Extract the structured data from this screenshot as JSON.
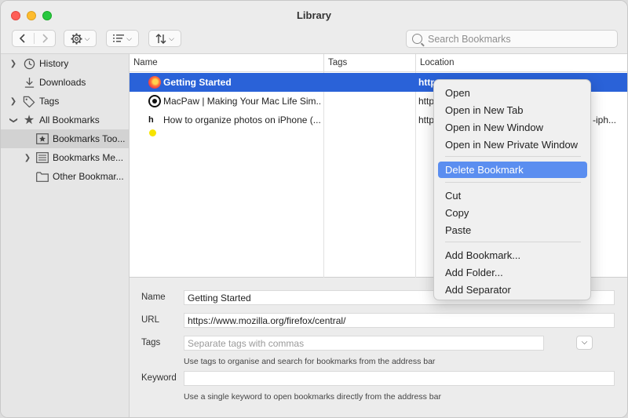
{
  "window": {
    "title": "Library"
  },
  "toolbar": {
    "back_icon": "chevron-left-icon",
    "forward_icon": "chevron-right-icon",
    "organize_icon": "gear-icon",
    "views_icon": "list-icon",
    "sort_icon": "sort-icon",
    "search_placeholder": "Search Bookmarks"
  },
  "sidebar": {
    "items": [
      {
        "label": "History",
        "icon": "clock-icon"
      },
      {
        "label": "Downloads",
        "icon": "download-icon"
      },
      {
        "label": "Tags",
        "icon": "tag-icon"
      },
      {
        "label": "All Bookmarks",
        "icon": "star-icon"
      },
      {
        "label": "Bookmarks Too...",
        "icon": "bookmark-toolbar-icon"
      },
      {
        "label": "Bookmarks Me...",
        "icon": "bookmark-menu-icon"
      },
      {
        "label": "Other Bookmar...",
        "icon": "folder-icon"
      }
    ]
  },
  "list": {
    "columns": [
      "Name",
      "Tags",
      "Location"
    ],
    "rows": [
      {
        "name": "Getting Started",
        "tags": "",
        "location": "https://www.mozilla.org/firefox/central/",
        "favicon": "firefox-icon"
      },
      {
        "name": "MacPaw | Making Your Mac Life Sim...",
        "tags": "",
        "location": "http",
        "favicon": "macpaw-icon"
      },
      {
        "name": "How to organize photos on iPhone (...",
        "tags": "",
        "location": "http",
        "location_tail": "-iph...",
        "favicon": "hb-icon"
      }
    ]
  },
  "details": {
    "name_label": "Name",
    "name_value": "Getting Started",
    "url_label": "URL",
    "url_value": "https://www.mozilla.org/firefox/central/",
    "tags_label": "Tags",
    "tags_placeholder": "Separate tags with commas",
    "tags_hint": "Use tags to organise and search for bookmarks from the address bar",
    "keyword_label": "Keyword",
    "keyword_value": "",
    "keyword_hint": "Use a single keyword to open bookmarks directly from the address bar"
  },
  "context_menu": {
    "items": [
      "Open",
      "Open in New Tab",
      "Open in New Window",
      "Open in New Private Window",
      "Delete Bookmark",
      "Cut",
      "Copy",
      "Paste",
      "Add Bookmark...",
      "Add Folder...",
      "Add Separator"
    ],
    "highlight_color": "#5b8ef0"
  },
  "colors": {
    "selection": "#2a62d8"
  }
}
